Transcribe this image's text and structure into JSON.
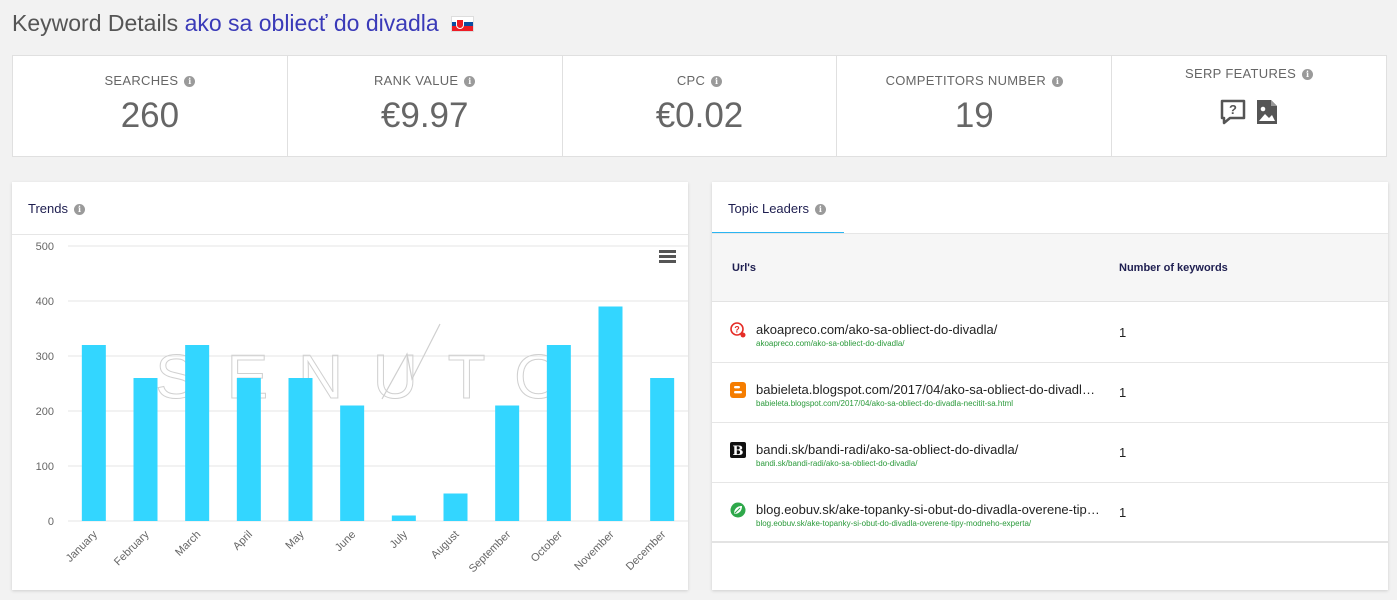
{
  "header": {
    "title_prefix": "Keyword Details",
    "keyword": "ako sa obliecť do divadla"
  },
  "stats": [
    {
      "label": "SEARCHES",
      "value": "260"
    },
    {
      "label": "RANK VALUE",
      "value": "€9.97"
    },
    {
      "label": "CPC",
      "value": "€0.02"
    },
    {
      "label": "COMPETITORS NUMBER",
      "value": "19"
    },
    {
      "label": "SERP FEATURES",
      "icons": [
        "question-answer-icon",
        "image-icon"
      ]
    }
  ],
  "trends": {
    "title": "Trends",
    "watermark": "SENUTO"
  },
  "chart_data": {
    "type": "bar",
    "categories": [
      "January",
      "February",
      "March",
      "April",
      "May",
      "June",
      "July",
      "August",
      "September",
      "October",
      "November",
      "December"
    ],
    "values": [
      320,
      260,
      320,
      260,
      260,
      210,
      10,
      50,
      210,
      320,
      390,
      260
    ],
    "yticks": [
      "0",
      "100",
      "200",
      "300",
      "400",
      "500"
    ],
    "ylim": [
      0,
      500
    ],
    "color": "#33d6ff",
    "grid": true
  },
  "leaders": {
    "tab_label": "Topic Leaders",
    "columns": [
      "Url's",
      "Number of keywords"
    ],
    "rows": [
      {
        "url": "akoapreco.com/ako-sa-obliect-do-divadla/",
        "full": "akoapreco.com/ako-sa-obliect-do-divadla/",
        "count": "1",
        "icon": "akoapreco-favicon-icon"
      },
      {
        "url": "babieleta.blogspot.com/2017/04/ako-sa-obliect-do-divadla-necitit-sa.html",
        "full": "babieleta.blogspot.com/2017/04/ako-sa-obliect-do-divadla-necitit-sa.html",
        "count": "1",
        "icon": "blogger-favicon-icon"
      },
      {
        "url": "bandi.sk/bandi-radi/ako-sa-obliect-do-divadla/",
        "full": "bandi.sk/bandi-radi/ako-sa-obliect-do-divadla/",
        "count": "1",
        "icon": "bandi-favicon-icon"
      },
      {
        "url": "blog.eobuv.sk/ake-topanky-si-obut-do-divadla-overene-tipy-modneho-experta/",
        "full": "blog.eobuv.sk/ake-topanky-si-obut-do-divadla-overene-tipy-modneho-experta/",
        "count": "1",
        "icon": "eobuv-leaf-favicon-icon"
      }
    ]
  }
}
